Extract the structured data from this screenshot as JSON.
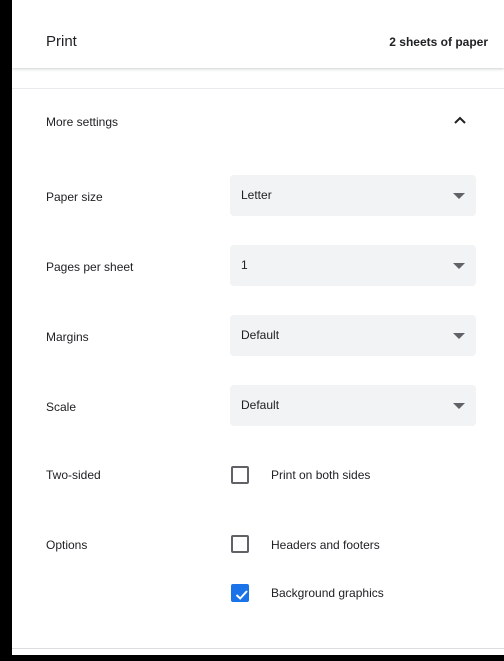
{
  "header": {
    "title": "Print",
    "sheets": "2 sheets of paper"
  },
  "more_settings": {
    "label": "More settings",
    "icon": "chevron-up-icon",
    "expanded": true
  },
  "settings": {
    "paper_size": {
      "label": "Paper size",
      "value": "Letter"
    },
    "pages_per_sheet": {
      "label": "Pages per sheet",
      "value": "1"
    },
    "margins": {
      "label": "Margins",
      "value": "Default"
    },
    "scale": {
      "label": "Scale",
      "value": "Default"
    },
    "two_sided": {
      "label": "Two-sided",
      "option": "Print on both sides",
      "checked": false
    },
    "options": {
      "label": "Options",
      "headers_footers": {
        "label": "Headers and footers",
        "checked": false
      },
      "background_graphics": {
        "label": "Background graphics",
        "checked": true
      }
    }
  },
  "colors": {
    "accent": "#1a73e8",
    "select_bg": "#f1f3f4",
    "text": "#202124",
    "icon": "#5f6368"
  }
}
